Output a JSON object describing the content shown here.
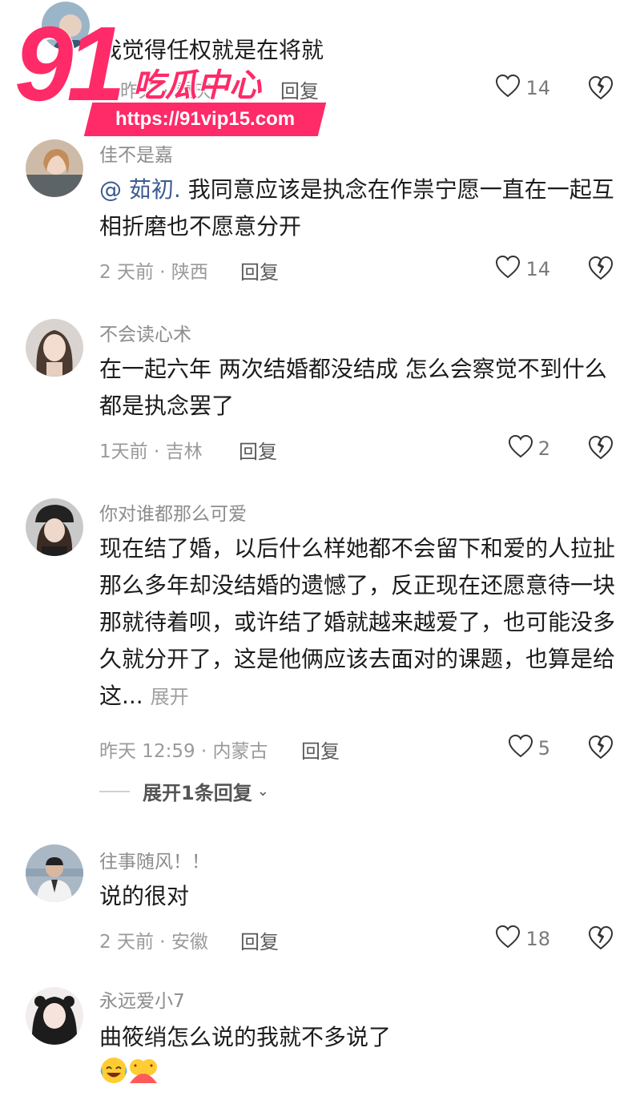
{
  "watermark": {
    "number": "91",
    "title": "吃瓜中心",
    "url": "https://91vip15.com"
  },
  "comments": [
    {
      "text": "我觉得任权就是在将就",
      "meta": "昨天 · 重庆",
      "reply_label": "回复",
      "likes": "14"
    },
    {
      "username": "佳不是嘉",
      "mention": "@ 茹初.",
      "text": " 我同意应该是执念在作祟宁愿一直在一起互相折磨也不愿意分开",
      "meta": "2 天前 · 陕西",
      "reply_label": "回复",
      "likes": "14"
    },
    {
      "username": "不会读心术",
      "text": "在一起六年 两次结婚都没结成 怎么会察觉不到什么 都是执念罢了",
      "meta": "1天前 · 吉林",
      "reply_label": "回复",
      "likes": "2"
    },
    {
      "username": "你对谁都那么可爱",
      "text": "现在结了婚，以后什么样她都不会留下和爱的人拉扯那么多年却没结婚的遗憾了，反正现在还愿意待一块那就待着呗，或许结了婚就越来越爱了，也可能没多久就分开了，这是他俩应该去面对的课题，也算是给这...",
      "expand_label": "展开",
      "meta": "昨天 12:59 · 内蒙古",
      "reply_label": "回复",
      "likes": "5",
      "expand_replies": "展开1条回复"
    },
    {
      "username": "往事随风！！",
      "text": "说的很对",
      "meta": "2 天前 · 安徽",
      "reply_label": "回复",
      "likes": "18"
    },
    {
      "username": "永远爱小7",
      "text": "曲筱绡怎么说的我就不多说了"
    }
  ],
  "colors": {
    "accent_pink": "#ff2a68",
    "mention_blue": "#3b5b91",
    "meta_gray": "#9a9a9a"
  },
  "icons": {
    "like": "heart-outline-icon",
    "dislike": "broken-heart-icon",
    "expand": "chevron-down-icon"
  }
}
